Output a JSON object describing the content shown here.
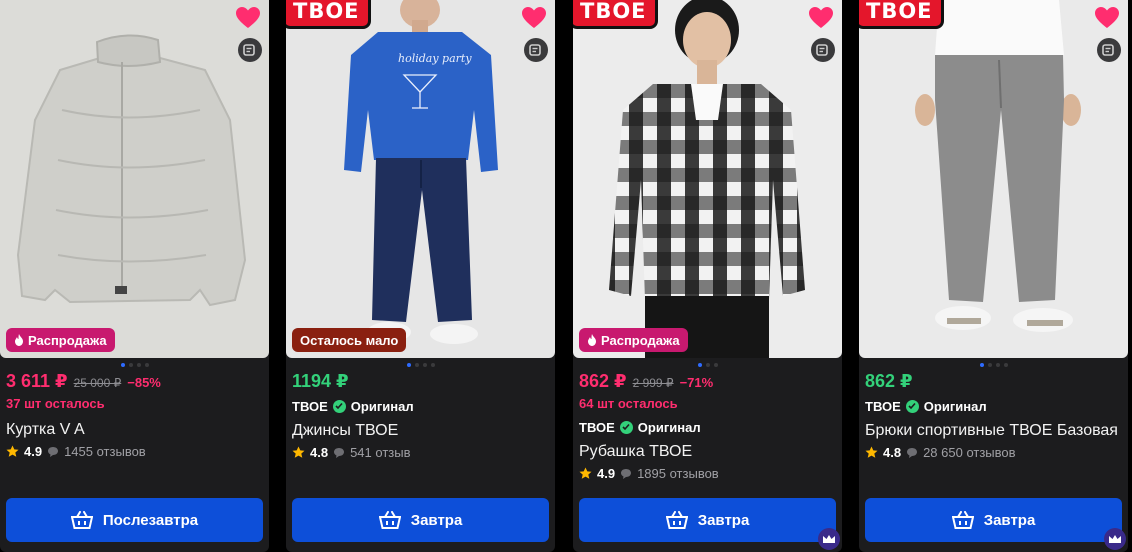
{
  "products": [
    {
      "brand_tag": "",
      "badge": "Распродажа",
      "badge_type": "sale",
      "price": "3 611 ₽",
      "price_type": "sale",
      "old_price": "25 000 ₽",
      "discount": "−85%",
      "stock_left": "37 шт осталось",
      "brand": "",
      "original_label": "",
      "title": "Куртка V A",
      "rating": "4.9",
      "reviews": "1455 отзывов",
      "delivery": "Послезавтра",
      "photo_bg": "#dfdfdc",
      "garment": "jacket",
      "has_crown": false
    },
    {
      "brand_tag": "ТВОЕ",
      "badge": "Осталось мало",
      "badge_type": "low",
      "price": "1194 ₽",
      "price_type": "green",
      "old_price": "",
      "discount": "",
      "stock_left": "",
      "brand": "ТВОЕ",
      "original_label": "Оригинал",
      "title": "Джинсы ТВОЕ",
      "rating": "4.8",
      "reviews": "541 отзыв",
      "delivery": "Завтра",
      "photo_bg": "#e9e9e9",
      "garment": "jeans",
      "has_crown": false
    },
    {
      "brand_tag": "ТВОЕ",
      "badge": "Распродажа",
      "badge_type": "sale",
      "price": "862 ₽",
      "price_type": "sale",
      "old_price": "2 999 ₽",
      "discount": "−71%",
      "stock_left": "64 шт осталось",
      "brand": "ТВОЕ",
      "original_label": "Оригинал",
      "title": "Рубашка ТВОЕ",
      "rating": "4.9",
      "reviews": "1895 отзывов",
      "delivery": "Завтра",
      "photo_bg": "#eeeeee",
      "garment": "shirt",
      "has_crown": true
    },
    {
      "brand_tag": "ТВОЕ",
      "badge": "",
      "badge_type": "",
      "price": "862 ₽",
      "price_type": "green",
      "old_price": "",
      "discount": "",
      "stock_left": "",
      "brand": "ТВОЕ",
      "original_label": "Оригинал",
      "title": "Брюки спортивные ТВОЕ Базовая",
      "rating": "4.8",
      "reviews": "28 650 отзывов",
      "delivery": "Завтра",
      "photo_bg": "#ececec",
      "garment": "pants",
      "has_crown": true
    }
  ],
  "colors": {
    "sale_price": "#ff2d6f",
    "green_price": "#33d17a",
    "buy_button": "#0d4fd9",
    "favorite_heart": "#ff2d6f",
    "brand_tag": "#e4162b",
    "card_bg": "#1c1c1e"
  },
  "icons": {
    "favorite": "heart-icon",
    "similar": "similar-search-icon",
    "badge": "fire-icon",
    "original": "check-icon",
    "star": "star-icon",
    "reviews": "chat-bubble-icon",
    "buy": "basket-icon",
    "premium": "crown-icon"
  }
}
